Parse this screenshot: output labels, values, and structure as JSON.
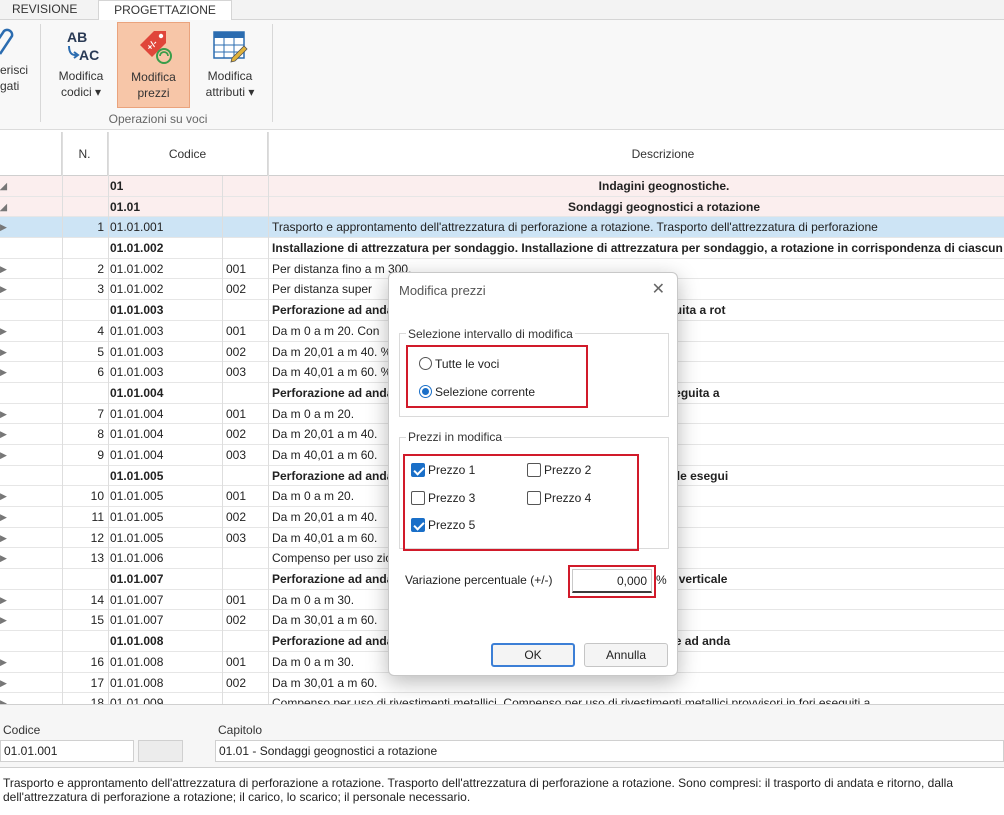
{
  "ribbon": {
    "tabs": [
      "REVISIONE",
      "PROGETTAZIONE"
    ],
    "partial_button": {
      "line1": "erisci",
      "line2": "gati"
    },
    "buttons": [
      {
        "line1": "Modifica",
        "line2": "codici ▾",
        "icon": "ab-ac-icon"
      },
      {
        "line1": "Modifica",
        "line2": "prezzi",
        "icon": "price-tag-icon"
      },
      {
        "line1": "Modifica",
        "line2": "attributi ▾",
        "icon": "table-edit-icon"
      }
    ],
    "group_label": "Operazioni su voci"
  },
  "grid": {
    "headers": {
      "n": "N.",
      "codice": "Codice",
      "descrizione": "Descrizione"
    },
    "rows": [
      {
        "type": "chap",
        "arrow": "◢",
        "n": "",
        "code": "01",
        "sub": "",
        "desc": "Indagini geognostiche."
      },
      {
        "type": "chap",
        "arrow": "◢",
        "n": "",
        "code": "01.01",
        "sub": "",
        "desc": "Sondaggi geognostici a rotazione"
      },
      {
        "type": "sel",
        "arrow": "▶",
        "n": "1",
        "code": "01.01.001",
        "sub": "",
        "desc": "Trasporto e approntamento dell'attrezzatura di perforazione a rotazione. Trasporto dell'attrezzatura di perforazione"
      },
      {
        "type": "bold",
        "arrow": "",
        "n": "",
        "code": "01.01.002",
        "sub": "",
        "desc": "Installazione di attrezzatura per sondaggio. Installazione di attrezzatura per sondaggio, a rotazione in corrispondenza di ciascun pu"
      },
      {
        "type": "",
        "arrow": "▶",
        "n": "2",
        "code": "01.01.002",
        "sub": "001",
        "desc": "Per distanza fino a m 300."
      },
      {
        "type": "",
        "arrow": "▶",
        "n": "3",
        "code": "01.01.002",
        "sub": "002",
        "desc": "Per distanza super"
      },
      {
        "type": "bold",
        "arrow": "",
        "n": "",
        "code": "01.01.003",
        "sub": "",
        "desc": "Perforazione ad anda                                                a fine. Perforazione ad andamento verticale eseguita a rot"
      },
      {
        "type": "",
        "arrow": "▶",
        "n": "4",
        "code": "01.01.003",
        "sub": "001",
        "desc": "Da m 0 a m 20. Con"
      },
      {
        "type": "",
        "arrow": "▶",
        "n": "5",
        "code": "01.01.003",
        "sub": "002",
        "desc": "Da m 20,01 a m 40.                                                   %."
      },
      {
        "type": "",
        "arrow": "▶",
        "n": "6",
        "code": "01.01.003",
        "sub": "003",
        "desc": "Da m 40,01 a m 60.                                                   %."
      },
      {
        "type": "bold",
        "arrow": "",
        "n": "",
        "code": "01.01.004",
        "sub": "",
        "desc": "Perforazione ad anda                                                a media. Perforazione ad andamento verticale eseguita a"
      },
      {
        "type": "",
        "arrow": "▶",
        "n": "7",
        "code": "01.01.004",
        "sub": "001",
        "desc": "Da m 0 a m 20."
      },
      {
        "type": "",
        "arrow": "▶",
        "n": "8",
        "code": "01.01.004",
        "sub": "002",
        "desc": "Da m 20,01 a m 40."
      },
      {
        "type": "",
        "arrow": "▶",
        "n": "9",
        "code": "01.01.004",
        "sub": "003",
        "desc": "Da m 40,01 a m 60."
      },
      {
        "type": "bold",
        "arrow": "",
        "n": "",
        "code": "01.01.005",
        "sub": "",
        "desc": "Perforazione ad anda                                                a grossolana. Perforazione ad andamento verticale esegui"
      },
      {
        "type": "",
        "arrow": "▶",
        "n": "10",
        "code": "01.01.005",
        "sub": "001",
        "desc": "Da m 0 a m 20."
      },
      {
        "type": "",
        "arrow": "▶",
        "n": "11",
        "code": "01.01.005",
        "sub": "002",
        "desc": "Da m 20,01 a m 40."
      },
      {
        "type": "",
        "arrow": "▶",
        "n": "12",
        "code": "01.01.005",
        "sub": "003",
        "desc": "Da m 40,01 a m 60."
      },
      {
        "type": "",
        "arrow": "▶",
        "n": "13",
        "code": "01.01.006",
        "sub": "",
        "desc": "Compenso per uso                                                    zione ad andamento verticale eseguita in terreni a"
      },
      {
        "type": "bold",
        "arrow": "",
        "n": "",
        "code": "01.01.007",
        "sub": "",
        "desc": "Perforazione ad anda                                                a granulometria fine. Perforazione ad andamento verticale"
      },
      {
        "type": "",
        "arrow": "▶",
        "n": "14",
        "code": "01.01.007",
        "sub": "001",
        "desc": "Da m 0 a m 30."
      },
      {
        "type": "",
        "arrow": "▶",
        "n": "15",
        "code": "01.01.007",
        "sub": "002",
        "desc": "Da m 30,01 a m 60."
      },
      {
        "type": "bold",
        "arrow": "",
        "n": "",
        "code": "01.01.008",
        "sub": "",
        "desc": "Perforazione ad anda                                                a granulometria media e grossolana. Perforazione ad anda"
      },
      {
        "type": "",
        "arrow": "▶",
        "n": "16",
        "code": "01.01.008",
        "sub": "001",
        "desc": "Da m 0 a m 30."
      },
      {
        "type": "",
        "arrow": "▶",
        "n": "17",
        "code": "01.01.008",
        "sub": "002",
        "desc": "Da m 30,01 a m 60."
      },
      {
        "type": "",
        "arrow": "▶",
        "n": "18",
        "code": "01.01.009",
        "sub": "",
        "desc": "Compenso per uso di rivestimenti metallici. Compenso per uso di rivestimenti metallici provvisori in fori eseguiti a"
      }
    ]
  },
  "bottom": {
    "codice_label": "Codice",
    "codice_value": "01.01.001",
    "capitolo_label": "Capitolo",
    "capitolo_value": "01.01 - Sondaggi geognostici a rotazione",
    "memo_line1": "Trasporto e approntamento dell'attrezzatura di perforazione a rotazione. Trasporto dell'attrezzatura di perforazione a rotazione. Sono compresi: il trasporto di andata e ritorno, dalla",
    "memo_line2": "dell'attrezzatura di perforazione a rotazione; il carico, lo scarico;  il personale necessario."
  },
  "dialog": {
    "title": "Modifica prezzi",
    "close": "✕",
    "group1_title": "Selezione intervallo di modifica",
    "radio_all": "Tutte le voci",
    "radio_current": "Selezione corrente",
    "selected_radio": "Selezione corrente",
    "group2_title": "Prezzi in modifica",
    "prezzo1": "Prezzo 1",
    "prezzo2": "Prezzo 2",
    "prezzo3": "Prezzo 3",
    "prezzo4": "Prezzo 4",
    "prezzo5": "Prezzo 5",
    "checked": [
      "Prezzo 1",
      "Prezzo 5"
    ],
    "variation_label": "Variazione percentuale (+/-)",
    "variation_value": "0,000",
    "percent": "%",
    "ok": "OK",
    "cancel": "Annulla",
    "highlight_color": "#d11a2a"
  },
  "colors": {
    "accent": "#1a6fc8",
    "active_ribbon": "#f7c6a8",
    "chapter_row": "#fbeeee",
    "selected_row": "#cde4f5"
  }
}
